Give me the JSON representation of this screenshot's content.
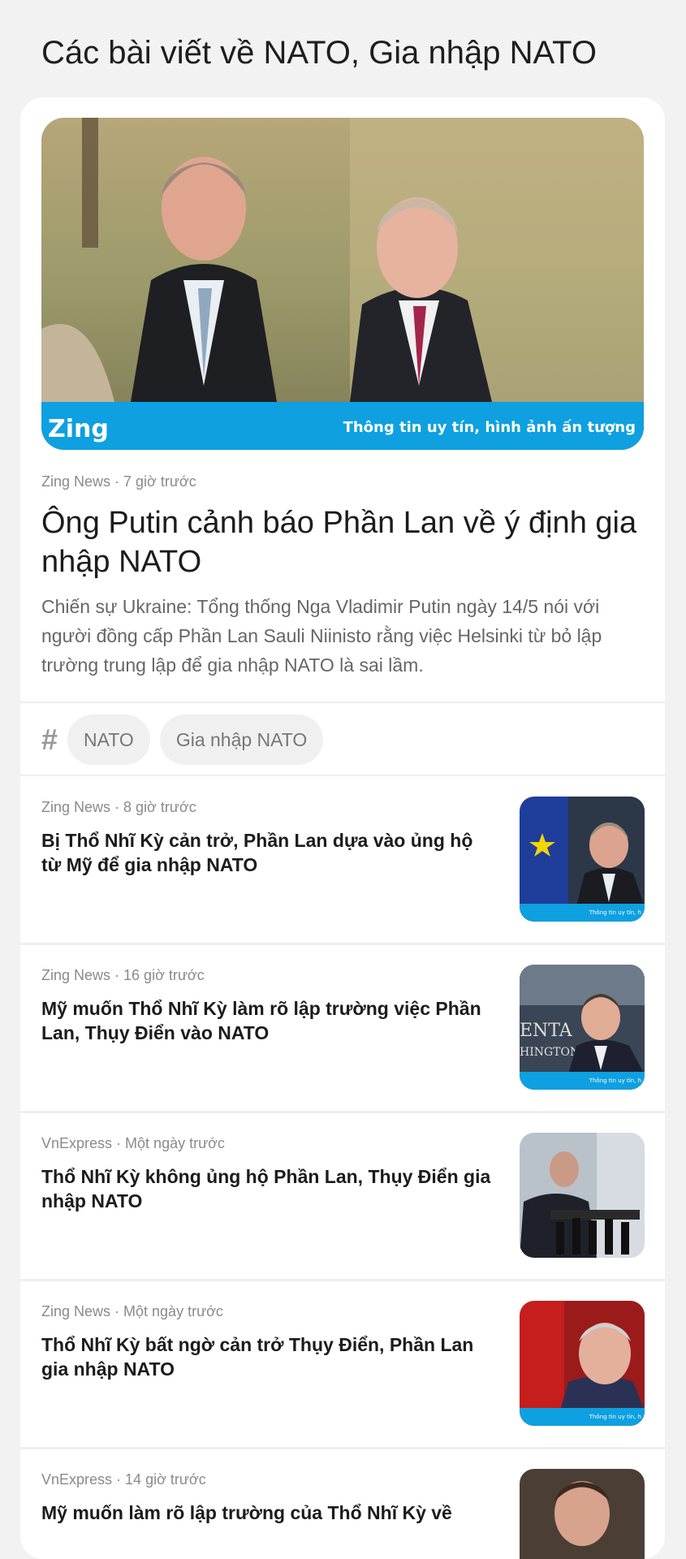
{
  "header": {
    "prefix": "Các bài viết về ",
    "topic": "NATO, Gia nhập NATO"
  },
  "hero": {
    "source": "Zing News",
    "time": "7 giờ trước",
    "title": "Ông Putin cảnh báo Phần Lan về ý định gia nhập NATO",
    "summary": "Chiến sự Ukraine: Tổng thống Nga Vladimir Putin ngày 14/5 nói với người đồng cấp Phần Lan Sauli Niinisto rằng việc Helsinki từ bỏ lập trường trung lập để gia nhập NATO là sai lầm.",
    "image_logo": "Zing",
    "image_tagline": "Thông tin uy tín, hình ảnh ấn tượng"
  },
  "tags": {
    "hash": "#",
    "items": [
      "NATO",
      "Gia nhập NATO"
    ]
  },
  "articles": [
    {
      "source": "Zing News",
      "time": "8 giờ trước",
      "title": "Bị Thổ Nhĩ Kỳ cản trở, Phần Lan dựa vào ủng hộ từ Mỹ để gia nhập NATO"
    },
    {
      "source": "Zing News",
      "time": "16 giờ trước",
      "title": "Mỹ muốn Thổ Nhĩ Kỳ làm rõ lập trường việc Phần Lan, Thụy Điển vào NATO"
    },
    {
      "source": "VnExpress",
      "time": "Một ngày trước",
      "title": "Thổ Nhĩ Kỳ không ủng hộ Phần Lan, Thụy Điển gia nhập NATO"
    },
    {
      "source": "Zing News",
      "time": "Một ngày trước",
      "title": "Thổ Nhĩ Kỳ bất ngờ cản trở Thụy Điển, Phần Lan gia nhập NATO"
    },
    {
      "source": "VnExpress",
      "time": "14 giờ trước",
      "title": "Mỹ muốn làm rõ lập trường của Thổ Nhĩ Kỳ về"
    }
  ],
  "thumb_tagline": "Thông tin uy tín, h",
  "thumb_banner_text_2": "ENTA",
  "thumb_banner_text_2b": "HINGTON",
  "separator_dot": " · ",
  "colors": {
    "zing_blue": "#0ea0e0",
    "background": "#f2f2f2",
    "card": "#ffffff"
  }
}
